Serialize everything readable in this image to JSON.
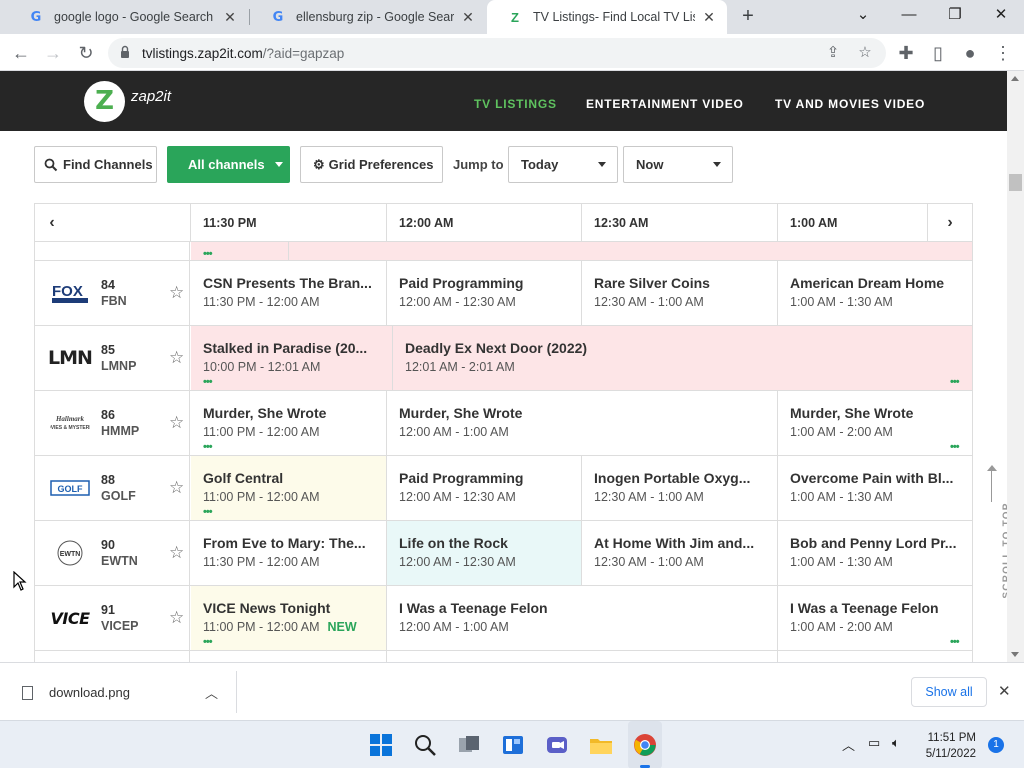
{
  "browser": {
    "tabs": [
      {
        "title": "google logo - Google Search",
        "favicon": "google-g",
        "active": false
      },
      {
        "title": "ellensburg zip - Google Search",
        "favicon": "google-g",
        "active": false
      },
      {
        "title": "TV Listings- Find Local TV Listings",
        "favicon": "zap2it-z",
        "active": true
      }
    ],
    "url_host": "tvlistings.zap2it.com",
    "url_path": "/?aid=gapzap"
  },
  "site": {
    "logo_text": "zap2it",
    "logo_letter": "Z",
    "nav": [
      {
        "label": "TV LISTINGS",
        "active": true
      },
      {
        "label": "ENTERTAINMENT VIDEO",
        "active": false
      },
      {
        "label": "TV AND MOVIES VIDEO",
        "active": false
      }
    ]
  },
  "controls": {
    "find_channels": "Find Channels",
    "all_channels": "All channels",
    "grid_preferences": "Grid Preferences",
    "jump_to": "Jump to",
    "day_value": "Today",
    "time_value": "Now"
  },
  "grid": {
    "times": [
      "11:30 PM",
      "12:00 AM",
      "12:30 AM",
      "1:00 AM"
    ],
    "channels": [
      {
        "logo": "FOX BUSINESS",
        "number": "84",
        "callsign": "FBN",
        "programs": [
          {
            "title": "CSN Presents The Bran...",
            "time": "11:30 PM - 12:00 AM"
          },
          {
            "title": "Paid Programming",
            "time": "12:00 AM - 12:30 AM"
          },
          {
            "title": "Rare Silver Coins",
            "time": "12:30 AM - 1:00 AM"
          },
          {
            "title": "American Dream Home",
            "time": "1:00 AM - 1:30 AM"
          }
        ]
      },
      {
        "logo": "LMN",
        "number": "85",
        "callsign": "LMNP",
        "programs": [
          {
            "title": "Stalked in Paradise (20...",
            "time": "10:00 PM - 12:01 AM"
          },
          {
            "title": "Deadly Ex Next Door (2022)",
            "time": "12:01 AM - 2:01 AM"
          }
        ]
      },
      {
        "logo": "Hallmark Movies & Mysteries",
        "number": "86",
        "callsign": "HMMP",
        "programs": [
          {
            "title": "Murder, She Wrote",
            "time": "11:00 PM - 12:00 AM"
          },
          {
            "title": "Murder, She Wrote",
            "time": "12:00 AM - 1:00 AM"
          },
          {
            "title": "Murder, She Wrote",
            "time": "1:00 AM - 2:00 AM"
          }
        ]
      },
      {
        "logo": "GOLF",
        "number": "88",
        "callsign": "GOLF",
        "programs": [
          {
            "title": "Golf Central",
            "time": "11:00 PM - 12:00 AM"
          },
          {
            "title": "Paid Programming",
            "time": "12:00 AM - 12:30 AM"
          },
          {
            "title": "Inogen Portable Oxyg...",
            "time": "12:30 AM - 1:00 AM"
          },
          {
            "title": "Overcome Pain with Bl...",
            "time": "1:00 AM - 1:30 AM"
          }
        ]
      },
      {
        "logo": "EWTN",
        "number": "90",
        "callsign": "EWTN",
        "programs": [
          {
            "title": "From Eve to Mary: The...",
            "time": "11:30 PM - 12:00 AM"
          },
          {
            "title": "Life on the Rock",
            "time": "12:00 AM - 12:30 AM"
          },
          {
            "title": "At Home With Jim and...",
            "time": "12:30 AM - 1:00 AM"
          },
          {
            "title": "Bob and Penny Lord Pr...",
            "time": "1:00 AM - 1:30 AM"
          }
        ]
      },
      {
        "logo": "VICE",
        "number": "91",
        "callsign": "VICEP",
        "programs": [
          {
            "title": "VICE News Tonight",
            "time": "11:00 PM - 12:00 AM",
            "badge": "NEW"
          },
          {
            "title": "I Was a Teenage Felon",
            "time": "12:00 AM - 1:00 AM"
          },
          {
            "title": "I Was a Teenage Felon",
            "time": "1:00 AM - 2:00 AM"
          }
        ]
      }
    ],
    "scroll_to_top": "SCROLL TO TOP"
  },
  "downloads": {
    "file": "download.png",
    "show_all": "Show all"
  },
  "taskbar": {
    "time": "11:51 PM",
    "date": "5/11/2022",
    "notifications": "1"
  }
}
